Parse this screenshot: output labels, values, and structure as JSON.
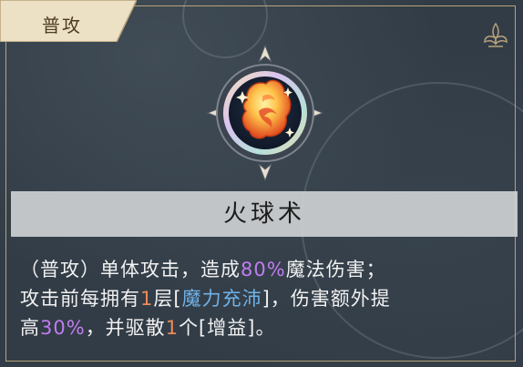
{
  "tag": {
    "label": "普攻"
  },
  "skill": {
    "icon": "fireball-icon",
    "name": "火球术"
  },
  "description": {
    "line1_a": "（普攻）单体攻击，造成",
    "line1_pct": "80%",
    "line1_b": "魔法伤害；",
    "line2_a": "攻击前每拥有",
    "line2_num": "1",
    "line2_b": "层[",
    "line2_buff": "魔力充沛",
    "line2_c": "]，伤害额外提",
    "line3_a": "高",
    "line3_pct": "30%",
    "line3_b": "，并驱散",
    "line3_num": "1",
    "line3_c": "个[增益]。"
  },
  "colors": {
    "percent": "#c07cf0",
    "count": "#ef8a56",
    "buff": "#6fb2e8"
  }
}
